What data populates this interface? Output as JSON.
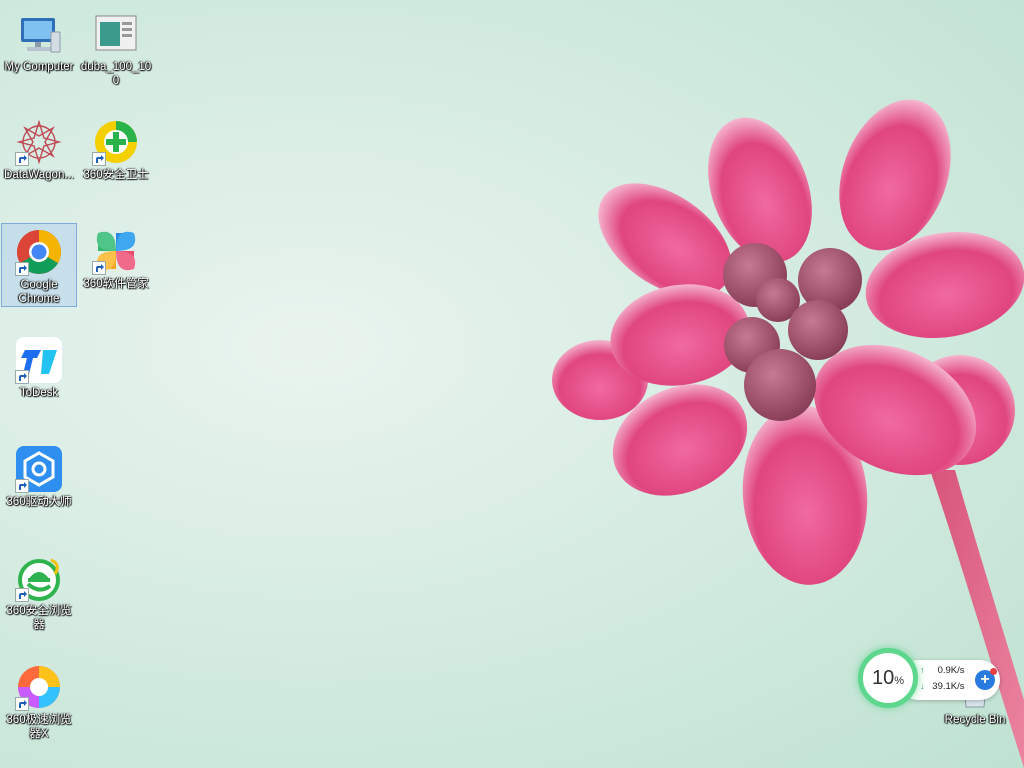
{
  "desktop": {
    "icons": [
      {
        "label": "My Computer"
      },
      {
        "label": "duba_100_100"
      },
      {
        "label": "DataWagon..."
      },
      {
        "label": "360安全卫士"
      },
      {
        "label": "Google Chrome"
      },
      {
        "label": "360软件管家"
      },
      {
        "label": "ToDesk"
      },
      {
        "label": "360驱动大师"
      },
      {
        "label": "360安全浏览器"
      },
      {
        "label": "360极速浏览器X"
      },
      {
        "label": "Recycle Bin"
      }
    ]
  },
  "net_widget": {
    "cpu_percent": "10",
    "percent_sign": "%",
    "upload_arrow": "↑",
    "upload_speed": "0.9K/s",
    "download_arrow": "↓",
    "download_speed": "39.1K/s",
    "plus": "+"
  },
  "colors": {
    "petal": "#e0457f",
    "wallpaper_bg": "#cfe9dd",
    "widget_ring": "#5fd68d",
    "plus_button": "#2a7be0"
  }
}
